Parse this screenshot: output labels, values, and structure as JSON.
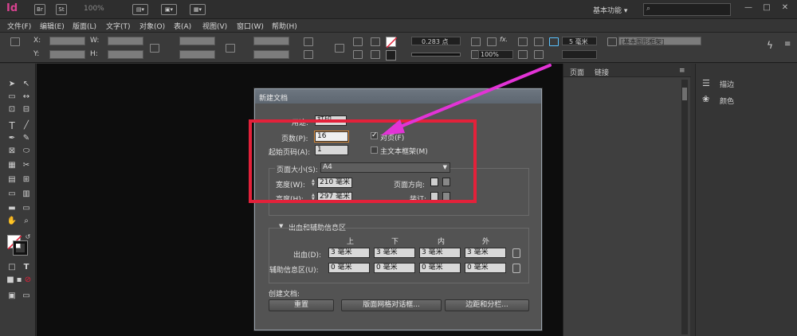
{
  "app": {
    "logo": "Id",
    "toolbar_buttons": [
      "Br",
      "St"
    ],
    "zoom": "100%",
    "workspace": "基本功能",
    "window_controls": [
      "—",
      "□",
      "✕"
    ]
  },
  "menu": [
    "文件(F)",
    "编辑(E)",
    "版面(L)",
    "文字(T)",
    "对象(O)",
    "表(A)",
    "视图(V)",
    "窗口(W)",
    "帮助(H)"
  ],
  "control_panel": {
    "x_label": "X:",
    "y_label": "Y:",
    "w_label": "W:",
    "h_label": "H:",
    "stroke_weight": "0.283 点",
    "opacity": "100%",
    "mm_value": "5 毫米",
    "style_dropdown": "[基本图形框架]"
  },
  "pages_panel": {
    "tabs": [
      "页面",
      "链接"
    ]
  },
  "side_panel": {
    "items": [
      "描边",
      "颜色"
    ]
  },
  "dialog": {
    "title": "新建文档",
    "purpose_label": "用途:",
    "purpose_value": "打印",
    "pages_label": "页数(P):",
    "pages_value": "16",
    "facing_label": "对页(F)",
    "facing_checked": true,
    "start_page_label": "起始页码(A):",
    "start_page_value": "1",
    "master_frame_label": "主文本框架(M)",
    "master_frame_checked": false,
    "page_size_label": "页面大小(S):",
    "page_size_value": "A4",
    "width_label": "宽度(W):",
    "width_value": "210 毫米",
    "height_label": "高度(H):",
    "height_value": "297 毫米",
    "orientation_label": "页面方向:",
    "binding_label": "装订:",
    "bleed_section_title": "出血和辅助信息区",
    "columns": [
      "上",
      "下",
      "内",
      "外"
    ],
    "bleed_label": "出血(D):",
    "bleed_values": [
      "3 毫米",
      "3 毫米",
      "3 毫米",
      "3 毫米"
    ],
    "slug_label": "辅助信息区(U):",
    "slug_values": [
      "0 毫米",
      "0 毫米",
      "0 毫米",
      "0 毫米"
    ],
    "create_label": "创建文档:",
    "buttons": [
      "重置",
      "版面网格对话框...",
      "边距和分栏..."
    ]
  },
  "colors": {
    "annotation_red": "#e3213a",
    "annotation_magenta": "#e233d6",
    "logo_pink": "#d7428f"
  }
}
